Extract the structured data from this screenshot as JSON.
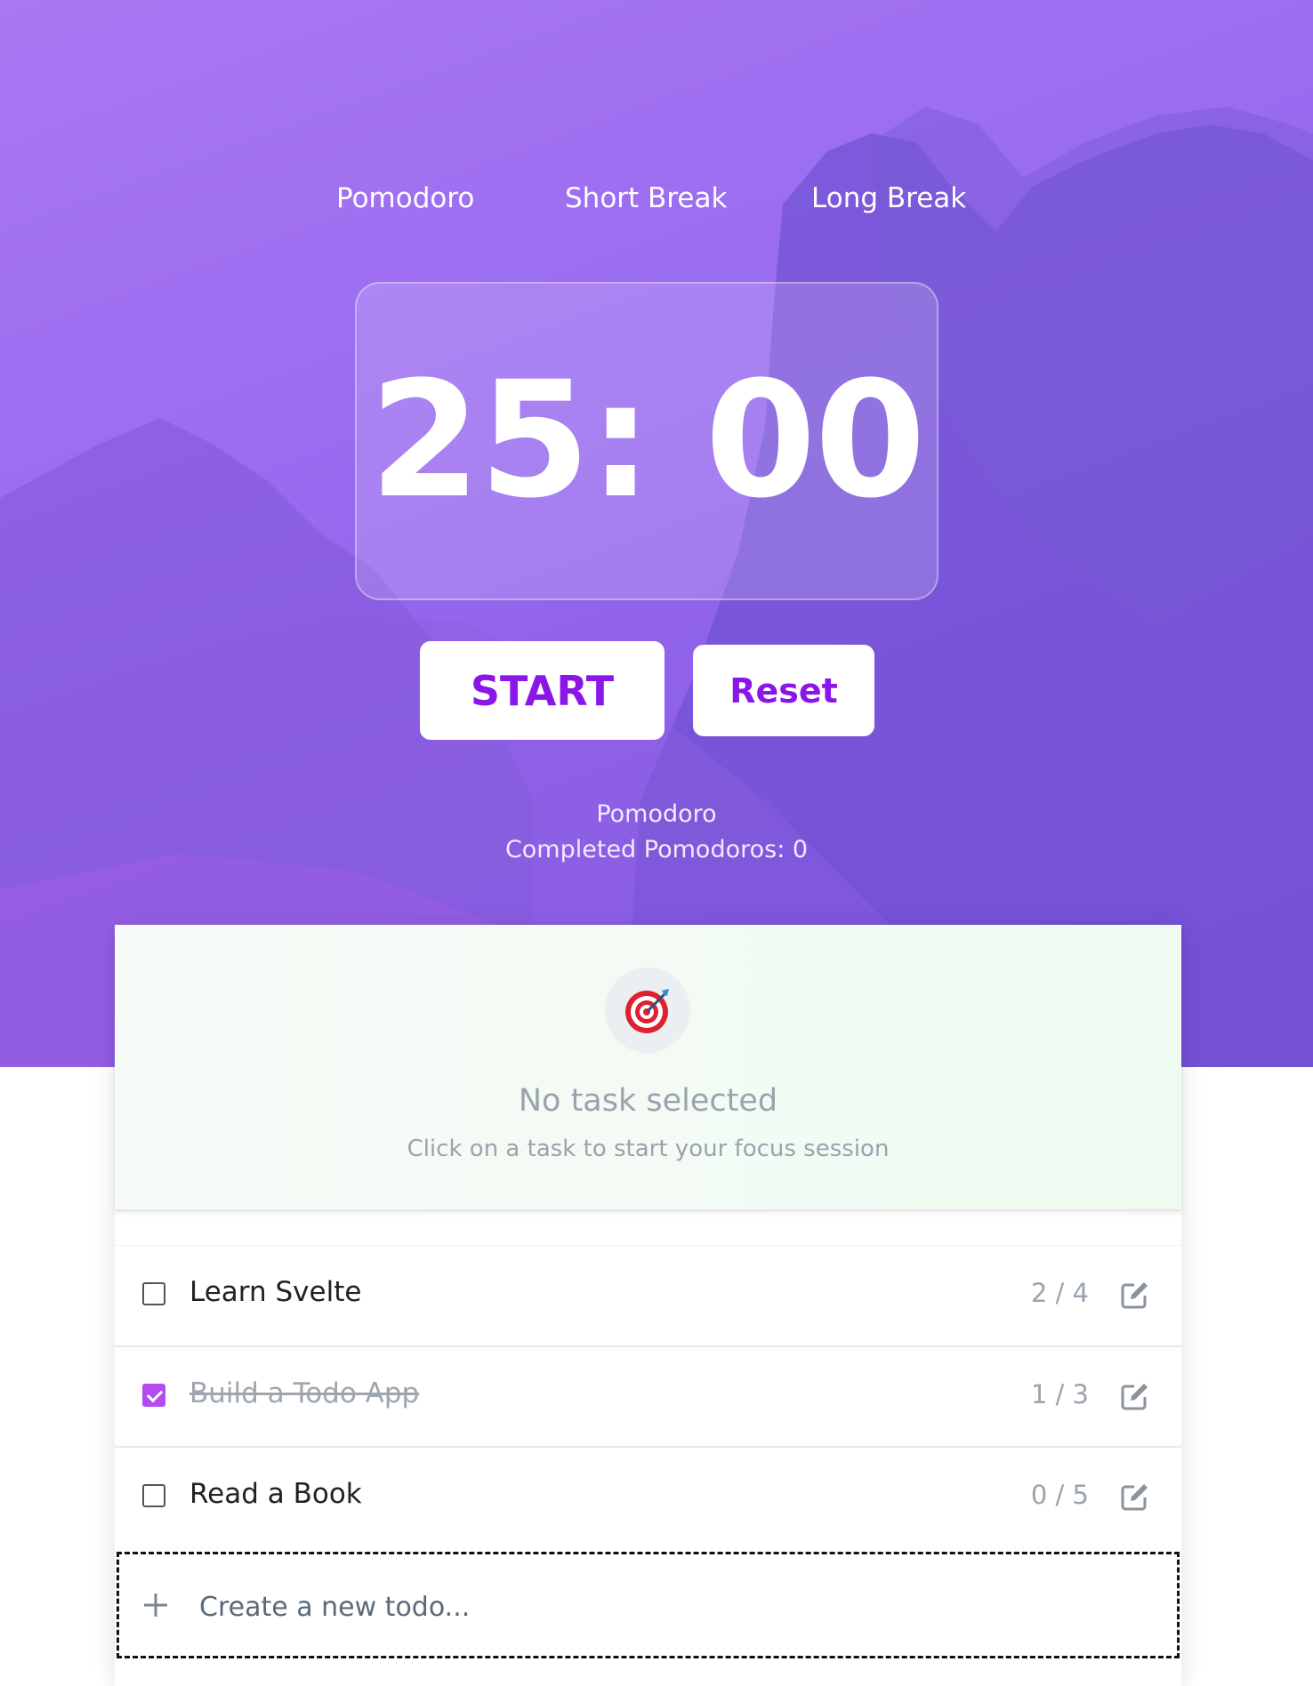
{
  "tabs": [
    {
      "label": "Pomodoro"
    },
    {
      "label": "Short Break"
    },
    {
      "label": "Long Break"
    }
  ],
  "timer": {
    "display": "25: 00"
  },
  "controls": {
    "start_label": "START",
    "reset_label": "Reset"
  },
  "status": {
    "mode": "Pomodoro",
    "completed": "Completed Pomodoros: 0"
  },
  "focus": {
    "icon": "target-icon",
    "title": "No task selected",
    "hint": "Click on a task to start your focus session"
  },
  "todos": [
    {
      "text": "Learn Svelte",
      "count": "2 / 4",
      "done": false
    },
    {
      "text": "Build a Todo App",
      "count": "1 / 3",
      "done": true
    },
    {
      "text": "Read a Book",
      "count": "0 / 5",
      "done": false
    }
  ],
  "new_todo": {
    "placeholder": "Create a new todo..."
  },
  "colors": {
    "accent": "#8a17e8",
    "checkbox": "#b24cf0",
    "hero": "#9a6cf0"
  }
}
